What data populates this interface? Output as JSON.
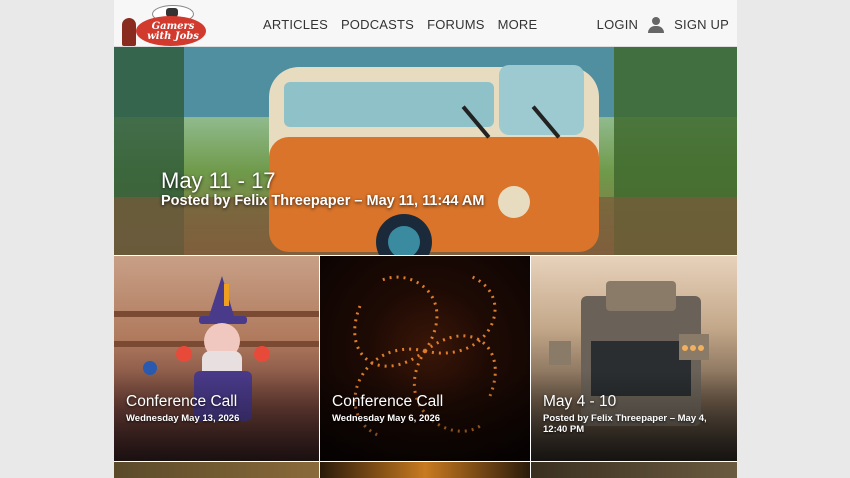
{
  "brand": {
    "logo_text_line1": "Gamers",
    "logo_text_line2": "with Jobs"
  },
  "nav": {
    "items": [
      "ARTICLES",
      "PODCASTS",
      "FORUMS",
      "MORE"
    ]
  },
  "auth": {
    "login": "LOGIN",
    "signup": "SIGN UP",
    "icon": "user-icon"
  },
  "hero": {
    "title": "May 11 - 17",
    "byline": "Posted by Felix Threepaper –  May 11, 11:44 AM"
  },
  "cards": [
    {
      "title": "Conference Call",
      "date": "Wednesday May 13, 2026"
    },
    {
      "title": "Conference Call",
      "date": "Wednesday May 6, 2026"
    },
    {
      "title": "May 4 - 10",
      "date": "Posted by Felix Threepaper –  May 4, 12:40 PM"
    }
  ],
  "colors": {
    "logo_red": "#d23a2e",
    "header_bg": "#f7f7f7",
    "page_bg": "#e9e9e9"
  }
}
